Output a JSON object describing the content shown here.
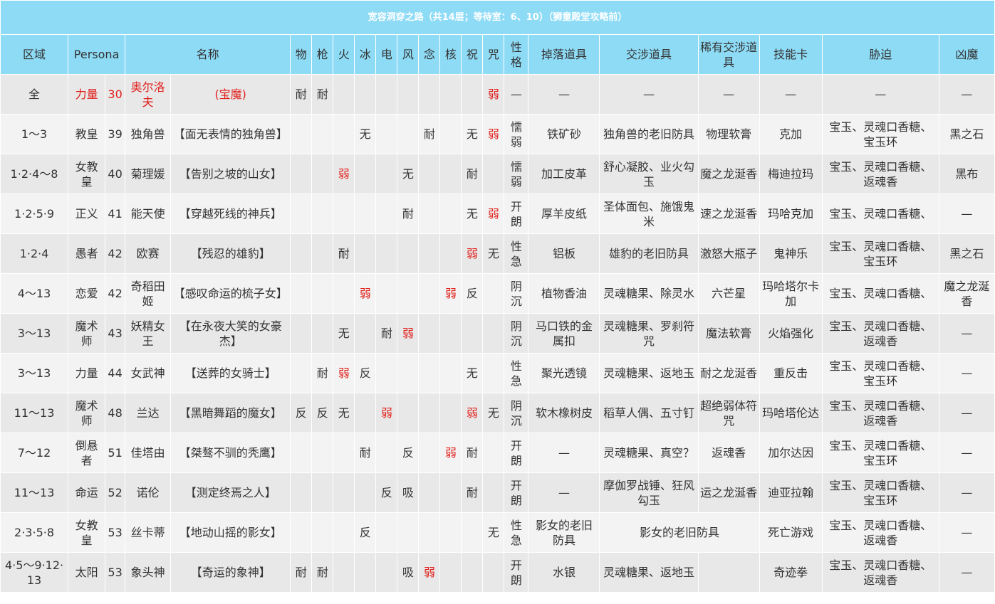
{
  "title": "宽容洞穿之路（共14层；等待室：6、10）（狮童殿堂攻略前）",
  "columns": [
    "区域",
    "Persona",
    "名称",
    "物",
    "枪",
    "火",
    "冰",
    "电",
    "风",
    "念",
    "核",
    "祝",
    "咒",
    "性格",
    "掉落道具",
    "交涉道具",
    "稀有交涉道具",
    "技能卡",
    "胁迫",
    "凶魔"
  ],
  "rows": [
    {
      "area": "全",
      "arcana": "力量",
      "level": "30",
      "name": "奥尔洛夫",
      "title": "(宝魔)",
      "phys": "耐",
      "gun": "耐",
      "fire": "",
      "ice": "",
      "elec": "",
      "wind": "",
      "psy": "",
      "nuke": "",
      "bless": "",
      "curse": "弱",
      "personality": "—",
      "drop": "—",
      "negotiate": "—",
      "rare": "—",
      "skill": "—",
      "threaten": "—",
      "demon": "—"
    },
    {
      "area": "1～3",
      "arcana": "教皇",
      "level": "39",
      "name": "独角兽",
      "title": "【面无表情的独角兽】",
      "phys": "",
      "gun": "",
      "fire": "",
      "ice": "无",
      "elec": "",
      "wind": "",
      "psy": "耐",
      "nuke": "",
      "bless": "无",
      "curse": "弱",
      "personality": "懦弱",
      "drop": "铁矿砂",
      "negotiate": "独角兽的老旧防具",
      "rare": "物理软膏",
      "skill": "克加",
      "threaten": "宝玉、灵魂口香糖、宝玉环",
      "demon": "黑之石"
    },
    {
      "area": "1·2·4～8",
      "arcana": "女教皇",
      "level": "40",
      "name": "菊理媛",
      "title": "【告别之坡的山女】",
      "phys": "",
      "gun": "",
      "fire": "弱",
      "ice": "",
      "elec": "",
      "wind": "无",
      "psy": "",
      "nuke": "",
      "bless": "耐",
      "curse": "",
      "personality": "懦弱",
      "drop": "加工皮革",
      "negotiate": "舒心凝胶、业火勾玉",
      "rare": "魔之龙涎香",
      "skill": "梅迪拉玛",
      "threaten": "宝玉、灵魂口香糖、返魂香",
      "demon": "黑布"
    },
    {
      "area": "1·2·5·9",
      "arcana": "正义",
      "level": "41",
      "name": "能天使",
      "title": "【穿越死线的神兵】",
      "phys": "",
      "gun": "",
      "fire": "",
      "ice": "",
      "elec": "",
      "wind": "耐",
      "psy": "",
      "nuke": "",
      "bless": "无",
      "curse": "弱",
      "personality": "开朗",
      "drop": "厚羊皮纸",
      "negotiate": "圣体面包、施饿鬼米",
      "rare": "速之龙涎香",
      "skill": "玛哈克加",
      "threaten": "宝玉、灵魂口香糖、",
      "demon": "—"
    },
    {
      "area": "1·2·4",
      "arcana": "愚者",
      "level": "42",
      "name": "欧赛",
      "title": "【残忍的雄豹】",
      "phys": "",
      "gun": "",
      "fire": "耐",
      "ice": "",
      "elec": "",
      "wind": "",
      "psy": "",
      "nuke": "",
      "bless": "弱",
      "curse": "无",
      "personality": "性急",
      "drop": "铝板",
      "negotiate": "雄豹的老旧防具",
      "rare": "激怒大瓶子",
      "skill": "鬼神乐",
      "threaten": "宝玉、灵魂口香糖、宝玉环",
      "demon": "黑之石"
    },
    {
      "area": "4～13",
      "arcana": "恋爱",
      "level": "42",
      "name": "奇稻田姬",
      "title": "【感叹命运的梳子女】",
      "phys": "",
      "gun": "",
      "fire": "",
      "ice": "弱",
      "elec": "",
      "wind": "",
      "psy": "",
      "nuke": "弱",
      "bless": "反",
      "curse": "",
      "personality": "阴沉",
      "drop": "植物香油",
      "negotiate": "灵魂糖果、除灵水",
      "rare": "六芒星",
      "skill": "玛哈塔尔卡加",
      "threaten": "宝玉、灵魂口香糖、",
      "demon": "魔之龙涎香"
    },
    {
      "area": "3～13",
      "arcana": "魔术师",
      "level": "43",
      "name": "妖精女王",
      "title": "【在永夜大笑的女豪杰】",
      "phys": "",
      "gun": "",
      "fire": "无",
      "ice": "",
      "elec": "耐",
      "wind": "弱",
      "psy": "",
      "nuke": "",
      "bless": "",
      "curse": "",
      "personality": "阴沉",
      "drop": "马口铁的金属扣",
      "negotiate": "灵魂糖果、罗刹符咒",
      "rare": "魔法软膏",
      "skill": "火焰强化",
      "threaten": "宝玉、灵魂口香糖、返魂香",
      "demon": "—"
    },
    {
      "area": "3～13",
      "arcana": "力量",
      "level": "44",
      "name": "女武神",
      "title": "【送葬的女骑士】",
      "phys": "",
      "gun": "耐",
      "fire": "弱",
      "ice": "反",
      "elec": "",
      "wind": "",
      "psy": "",
      "nuke": "",
      "bless": "无",
      "curse": "",
      "personality": "性急",
      "drop": "聚光透镜",
      "negotiate": "灵魂糖果、返地玉",
      "rare": "耐之龙涎香",
      "skill": "重反击",
      "threaten": "宝玉、灵魂口香糖、宝玉环",
      "demon": "—"
    },
    {
      "area": "11～13",
      "arcana": "魔术师",
      "level": "48",
      "name": "兰达",
      "title": "【黑暗舞蹈的魔女】",
      "phys": "反",
      "gun": "反",
      "fire": "无",
      "ice": "",
      "elec": "弱",
      "wind": "",
      "psy": "",
      "nuke": "",
      "bless": "弱",
      "curse": "无",
      "personality": "阴沉",
      "drop": "软木橡树皮",
      "negotiate": "稻草人偶、五寸钉",
      "rare": "超绝弱体符咒",
      "skill": "玛哈塔伦达",
      "threaten": "宝玉、灵魂口香糖、返魂香",
      "demon": "—"
    },
    {
      "area": "7～12",
      "arcana": "倒悬者",
      "level": "51",
      "name": "佳塔由",
      "title": "【桀骜不驯的秃鹰】",
      "phys": "",
      "gun": "",
      "fire": "",
      "ice": "耐",
      "elec": "",
      "wind": "反",
      "psy": "",
      "nuke": "弱",
      "bless": "耐",
      "curse": "",
      "personality": "开朗",
      "drop": "—",
      "negotiate": "灵魂糖果、真空？",
      "rare": "返魂香",
      "skill": "加尔达因",
      "threaten": "宝玉、灵魂口香糖、宝玉环",
      "demon": "—"
    },
    {
      "area": "11～13",
      "arcana": "命运",
      "level": "52",
      "name": "诺伦",
      "title": "【测定终焉之人】",
      "phys": "",
      "gun": "",
      "fire": "",
      "ice": "",
      "elec": "反",
      "wind": "吸",
      "psy": "",
      "nuke": "",
      "bless": "耐",
      "curse": "",
      "personality": "开朗",
      "drop": "—",
      "negotiate": "摩伽罗战锤、狂风勾玉",
      "rare": "运之龙涎香",
      "skill": "迪亚拉翰",
      "threaten": "宝玉、灵魂口香糖、宝玉环",
      "demon": "—"
    },
    {
      "area": "2·3·5·8",
      "arcana": "女教皇",
      "level": "53",
      "name": "丝卡蒂",
      "title": "【地动山摇的影女】",
      "phys": "",
      "gun": "",
      "fire": "",
      "ice": "反",
      "elec": "",
      "wind": "",
      "psy": "",
      "nuke": "",
      "bless": "",
      "curse": "无",
      "personality": "性急",
      "drop": "影女的老旧防具",
      "negotiate": "影女的老旧防具",
      "rare": "",
      "skill": "死亡游戏",
      "threaten": "宝玉、灵魂口香糖、返魂香",
      "demon": "—"
    },
    {
      "area": "4·5～9·12·13",
      "arcana": "太阳",
      "level": "53",
      "name": "象头神",
      "title": "【奇运的象神】",
      "phys": "耐",
      "gun": "耐",
      "fire": "",
      "ice": "",
      "elec": "",
      "wind": "吸",
      "psy": "弱",
      "nuke": "",
      "bless": "",
      "curse": "",
      "personality": "开朗",
      "drop": "水银",
      "negotiate": "灵魂糖果、返地玉",
      "rare": "",
      "skill": "奇迹拳",
      "threaten": "宝玉、灵魂口香糖、返魂香",
      "demon": "—"
    }
  ],
  "colors": {
    "header_bg": "#8edbf6",
    "weak_text": "#e0201c",
    "row_odd": "#e8e8e8",
    "row_even": "#f3f3f3"
  }
}
